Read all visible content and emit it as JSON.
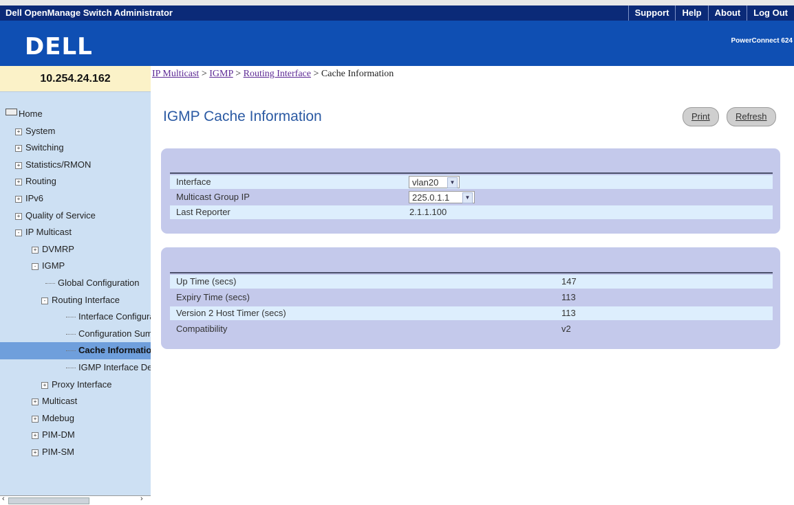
{
  "header": {
    "title": "Dell OpenManage Switch Administrator",
    "links": [
      "Support",
      "Help",
      "About",
      "Log Out"
    ],
    "logo": "DELL",
    "product": "PowerConnect 624"
  },
  "sidebar": {
    "ip": "10.254.24.162",
    "items": [
      {
        "label": "Home",
        "toggle": "",
        "icon": "home-icon"
      },
      {
        "label": "System",
        "toggle": "+"
      },
      {
        "label": "Switching",
        "toggle": "+"
      },
      {
        "label": "Statistics/RMON",
        "toggle": "+"
      },
      {
        "label": "Routing",
        "toggle": "+"
      },
      {
        "label": "IPv6",
        "toggle": "+"
      },
      {
        "label": "Quality of Service",
        "toggle": "+"
      },
      {
        "label": "IP Multicast",
        "toggle": "-"
      },
      {
        "label": "DVMRP",
        "toggle": "+"
      },
      {
        "label": "IGMP",
        "toggle": "-"
      },
      {
        "label": "Global Configuration",
        "toggle": ""
      },
      {
        "label": "Routing Interface",
        "toggle": "-"
      },
      {
        "label": "Interface Configura",
        "toggle": ""
      },
      {
        "label": "Configuration Sum",
        "toggle": ""
      },
      {
        "label": "Cache Informatio",
        "toggle": "",
        "selected": true
      },
      {
        "label": "IGMP Interface De",
        "toggle": ""
      },
      {
        "label": "Proxy Interface",
        "toggle": "+"
      },
      {
        "label": "Multicast",
        "toggle": "+"
      },
      {
        "label": "Mdebug",
        "toggle": "+"
      },
      {
        "label": "PIM-DM",
        "toggle": "+"
      },
      {
        "label": "PIM-SM",
        "toggle": "+"
      }
    ]
  },
  "breadcrumb": {
    "items": [
      "IP Multicast",
      "IGMP",
      "Routing Interface",
      "Cache Information"
    ],
    "separator": ">"
  },
  "page": {
    "title": "IGMP Cache Information",
    "print_label": "Print",
    "refresh_label": "Refresh"
  },
  "panel1": {
    "rows": [
      {
        "label": "Interface",
        "value": "vlan20",
        "type": "select"
      },
      {
        "label": "Multicast Group IP",
        "value": "225.0.1.1",
        "type": "select"
      },
      {
        "label": "Last Reporter",
        "value": "2.1.1.100",
        "type": "text"
      }
    ]
  },
  "panel2": {
    "rows": [
      {
        "label": "Up Time (secs)",
        "value": "147"
      },
      {
        "label": "Expiry Time (secs)",
        "value": "113"
      },
      {
        "label": "Version 2 Host Timer (secs)",
        "value": "113"
      },
      {
        "label": "Compatibility",
        "value": "v2"
      }
    ]
  },
  "colors": {
    "topbar": "#0b2a78",
    "banner": "#0f4fb3",
    "sidebar": "#cde0f3",
    "ip_box": "#fbf2c8",
    "selected": "#6f9fdc",
    "panel": "#c4c9eb",
    "row_alt": "#ddeefd",
    "title": "#2b5aa3"
  }
}
